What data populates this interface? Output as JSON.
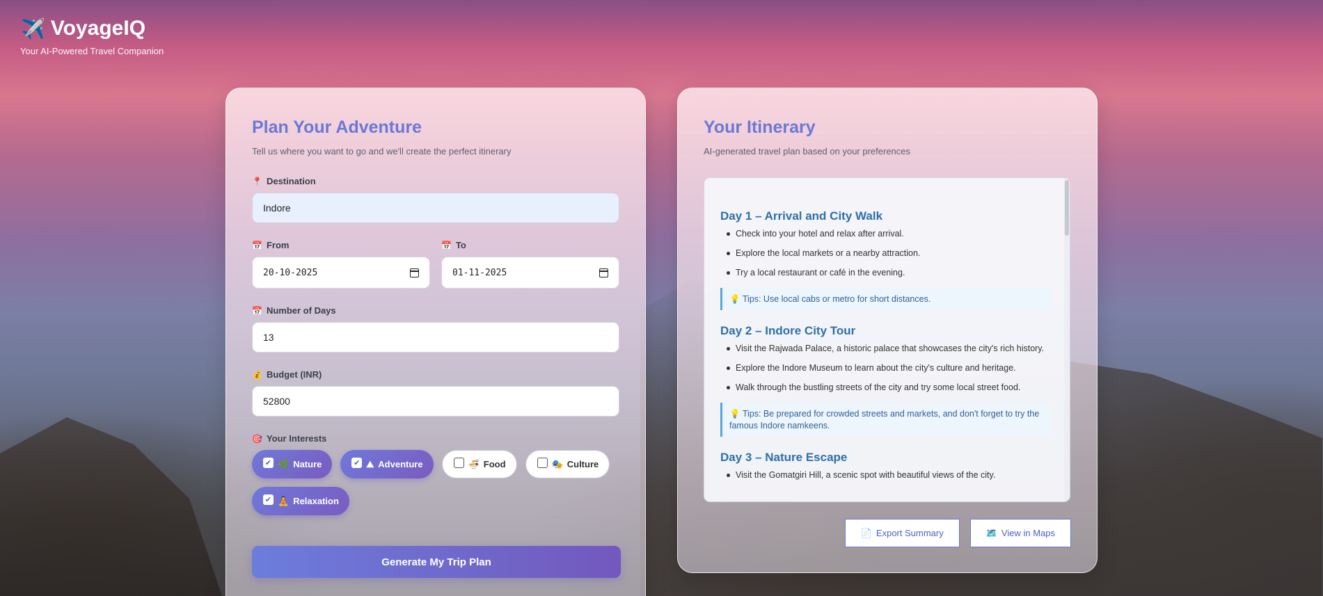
{
  "brand": {
    "title": "VoyageIQ",
    "subtitle": "Your AI-Powered Travel Companion",
    "icon": "airplane-icon"
  },
  "planner": {
    "title": "Plan Your Adventure",
    "subtitle": "Tell us where you want to go and we'll create the perfect itinerary",
    "destination": {
      "label": "Destination",
      "icon": "pin-icon",
      "value": "Indore"
    },
    "from": {
      "label": "From",
      "icon": "calendar-icon",
      "value": "20-10-2025"
    },
    "to": {
      "label": "To",
      "icon": "calendar-icon",
      "value": "01-11-2025"
    },
    "days": {
      "label": "Number of Days",
      "icon": "calendar-icon",
      "value": "13"
    },
    "budget": {
      "label": "Budget (INR)",
      "icon": "money-bag-icon",
      "value": "52800"
    },
    "interests": {
      "label": "Your Interests",
      "icon": "target-icon",
      "items": [
        {
          "label": "Nature",
          "emoji": "🌿",
          "checked": true
        },
        {
          "label": "Adventure",
          "emoji": "⛰",
          "checked": true
        },
        {
          "label": "Food",
          "emoji": "🍜",
          "checked": false
        },
        {
          "label": "Culture",
          "emoji": "🎭",
          "checked": false
        },
        {
          "label": "Relaxation",
          "emoji": "🧘",
          "checked": true
        }
      ]
    },
    "generate_label": "Generate My Trip Plan"
  },
  "itinerary": {
    "title": "Your Itinerary",
    "subtitle": "AI-generated travel plan based on your preferences",
    "days": [
      {
        "title": "Day 1 – Arrival and City Walk",
        "items": [
          "Check into your hotel and relax after arrival.",
          "Explore the local markets or a nearby attraction.",
          "Try a local restaurant or café in the evening."
        ],
        "tip": "Tips: Use local cabs or metro for short distances."
      },
      {
        "title": "Day 2 – Indore City Tour",
        "items": [
          "Visit the Rajwada Palace, a historic palace that showcases the city's rich history.",
          "Explore the Indore Museum to learn about the city's culture and heritage.",
          "Walk through the bustling streets of the city and try some local street food."
        ],
        "tip": "Tips: Be prepared for crowded streets and markets, and don't forget to try the famous Indore namkeens."
      },
      {
        "title": "Day 3 – Nature Escape",
        "items": [
          "Visit the Gomatgiri Hill, a scenic spot with beautiful views of the city."
        ],
        "tip": ""
      }
    ],
    "export_label": "Export Summary",
    "maps_label": "View in Maps"
  }
}
